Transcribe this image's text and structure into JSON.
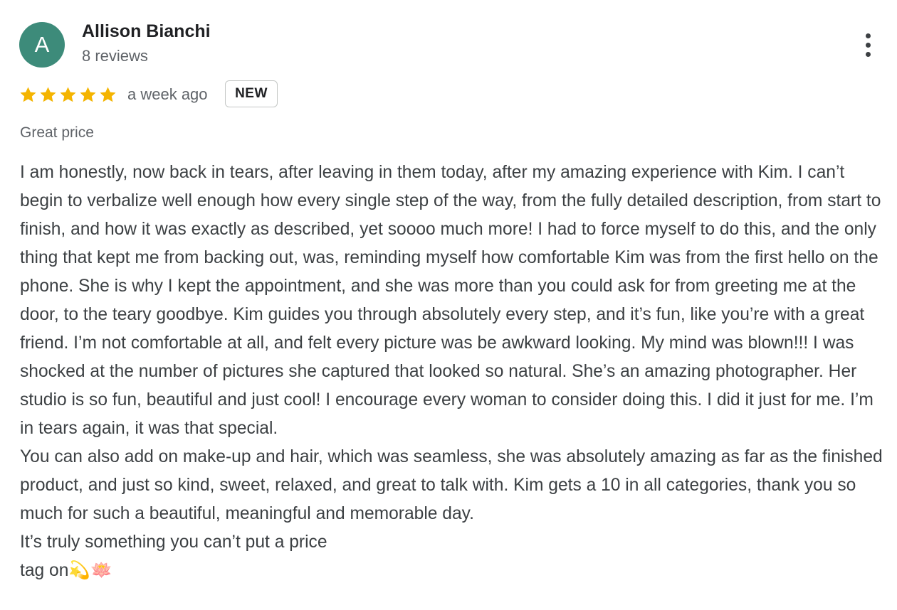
{
  "reviewer": {
    "avatar_letter": "A",
    "avatar_color": "#3d8b7a",
    "name": "Allison Bianchi",
    "review_count": "8 reviews"
  },
  "menu": {
    "icon": "more-vertical-icon"
  },
  "rating": {
    "stars": 5,
    "max_stars": 5,
    "star_color": "#f4b400",
    "time_ago": "a week ago",
    "badge": "NEW"
  },
  "review": {
    "tag": "Great price",
    "paragraphs": [
      "I am honestly, now back in tears, after leaving in them today, after my amazing experience with Kim. I can’t begin to verbalize well enough how every single step of the way, from the fully detailed description, from start to finish, and how it was exactly as described, yet soooo much more! I had to force myself to do this, and the only thing that kept me from backing out, was, reminding myself how comfortable Kim was from the first hello on the phone. She is why I kept the appointment, and she was more than you could ask for from greeting me at the door, to the teary goodbye. Kim guides you through absolutely every step, and it’s fun, like you’re with a great friend. I’m not comfortable at all, and felt every picture was be awkward looking. My mind was blown!!! I was shocked at the number of pictures she captured that looked so natural. She’s an amazing photographer. Her studio is so fun, beautiful and just cool! I encourage every woman to consider doing this. I did it just for me. I’m in tears again, it was that special.",
      "You can also add on make-up and hair, which was seamless, she was absolutely amazing as far as the finished product, and just so kind, sweet, relaxed, and great to talk with. Kim gets a 10 in all categories, thank you so much for such a beautiful, meaningful and memorable day.",
      "It’s truly something you can’t put a price",
      "tag on💫🪷"
    ]
  }
}
